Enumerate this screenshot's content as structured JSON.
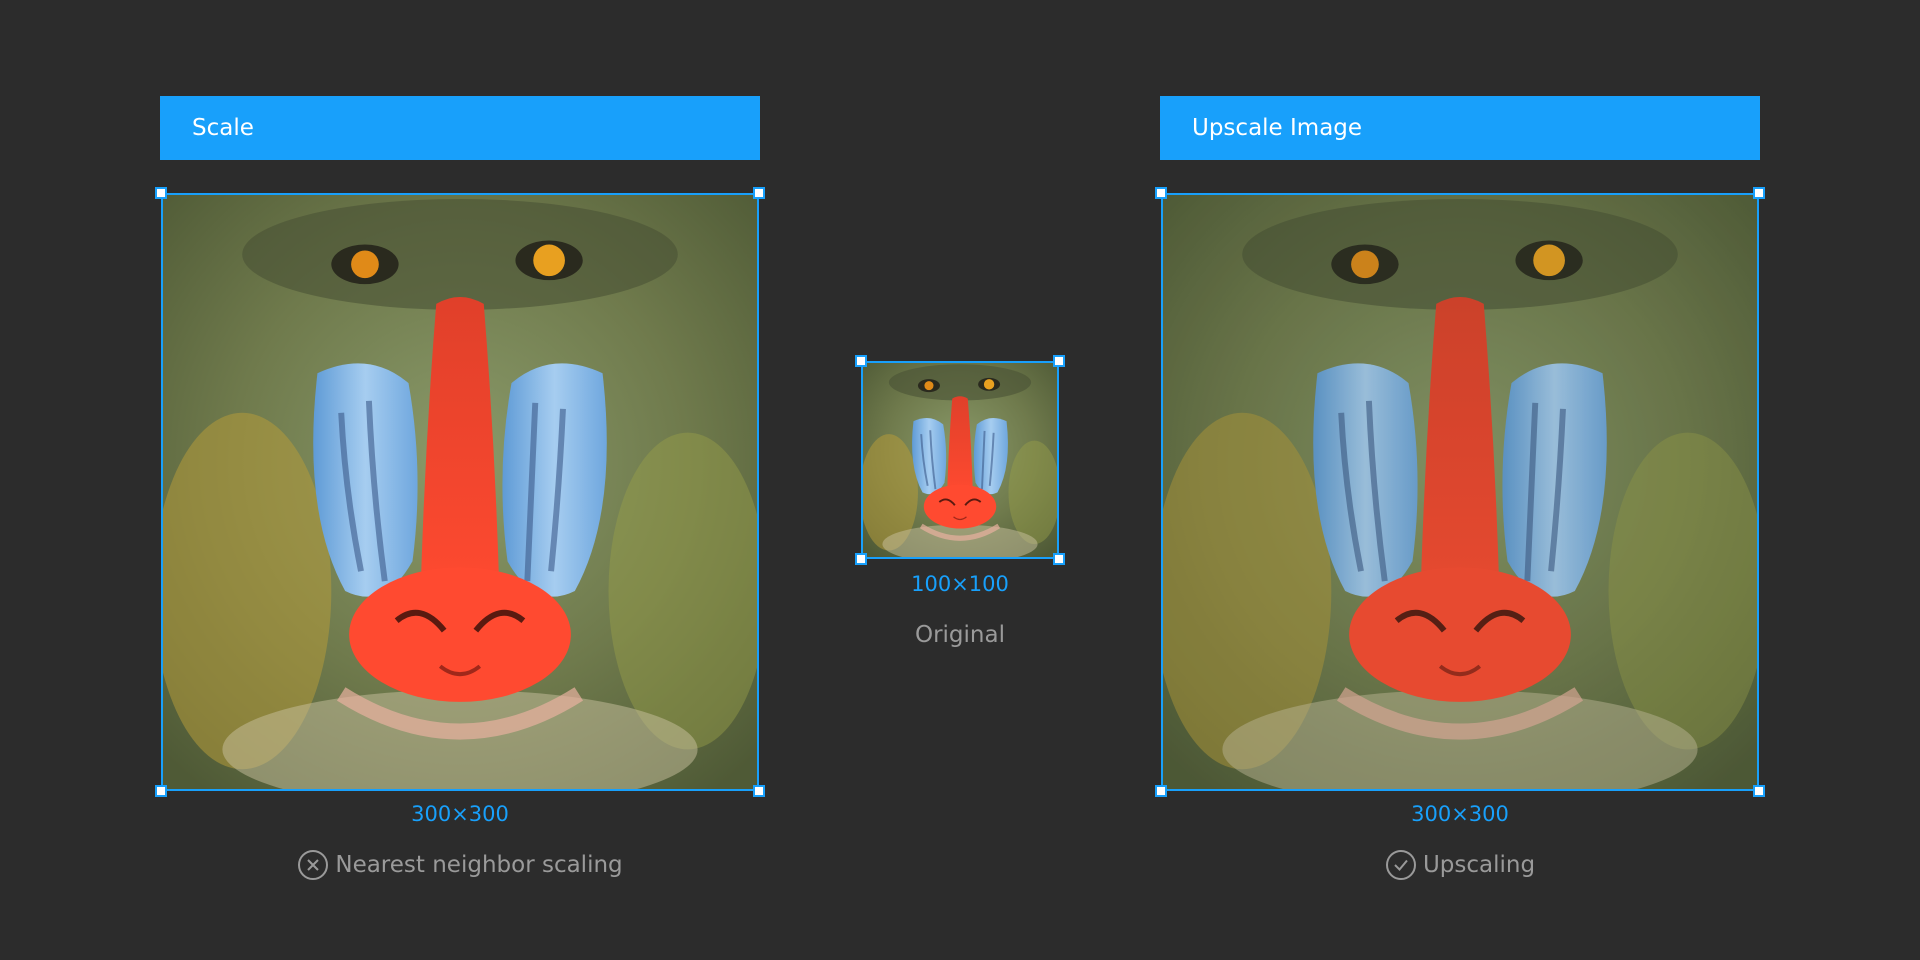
{
  "left_panel": {
    "title": "Scale",
    "dims": "300×300",
    "caption": "Nearest neighbor scaling",
    "caption_icon": "x-circle-icon"
  },
  "center_panel": {
    "dims": "100×100",
    "caption": "Original"
  },
  "right_panel": {
    "title": "Upscale Image",
    "dims": "300×300",
    "caption": "Upscaling",
    "caption_icon": "check-circle-icon"
  },
  "colors": {
    "background": "#2c2c2c",
    "accent": "#18a0fb",
    "caption_text": "#9a9a9a"
  }
}
